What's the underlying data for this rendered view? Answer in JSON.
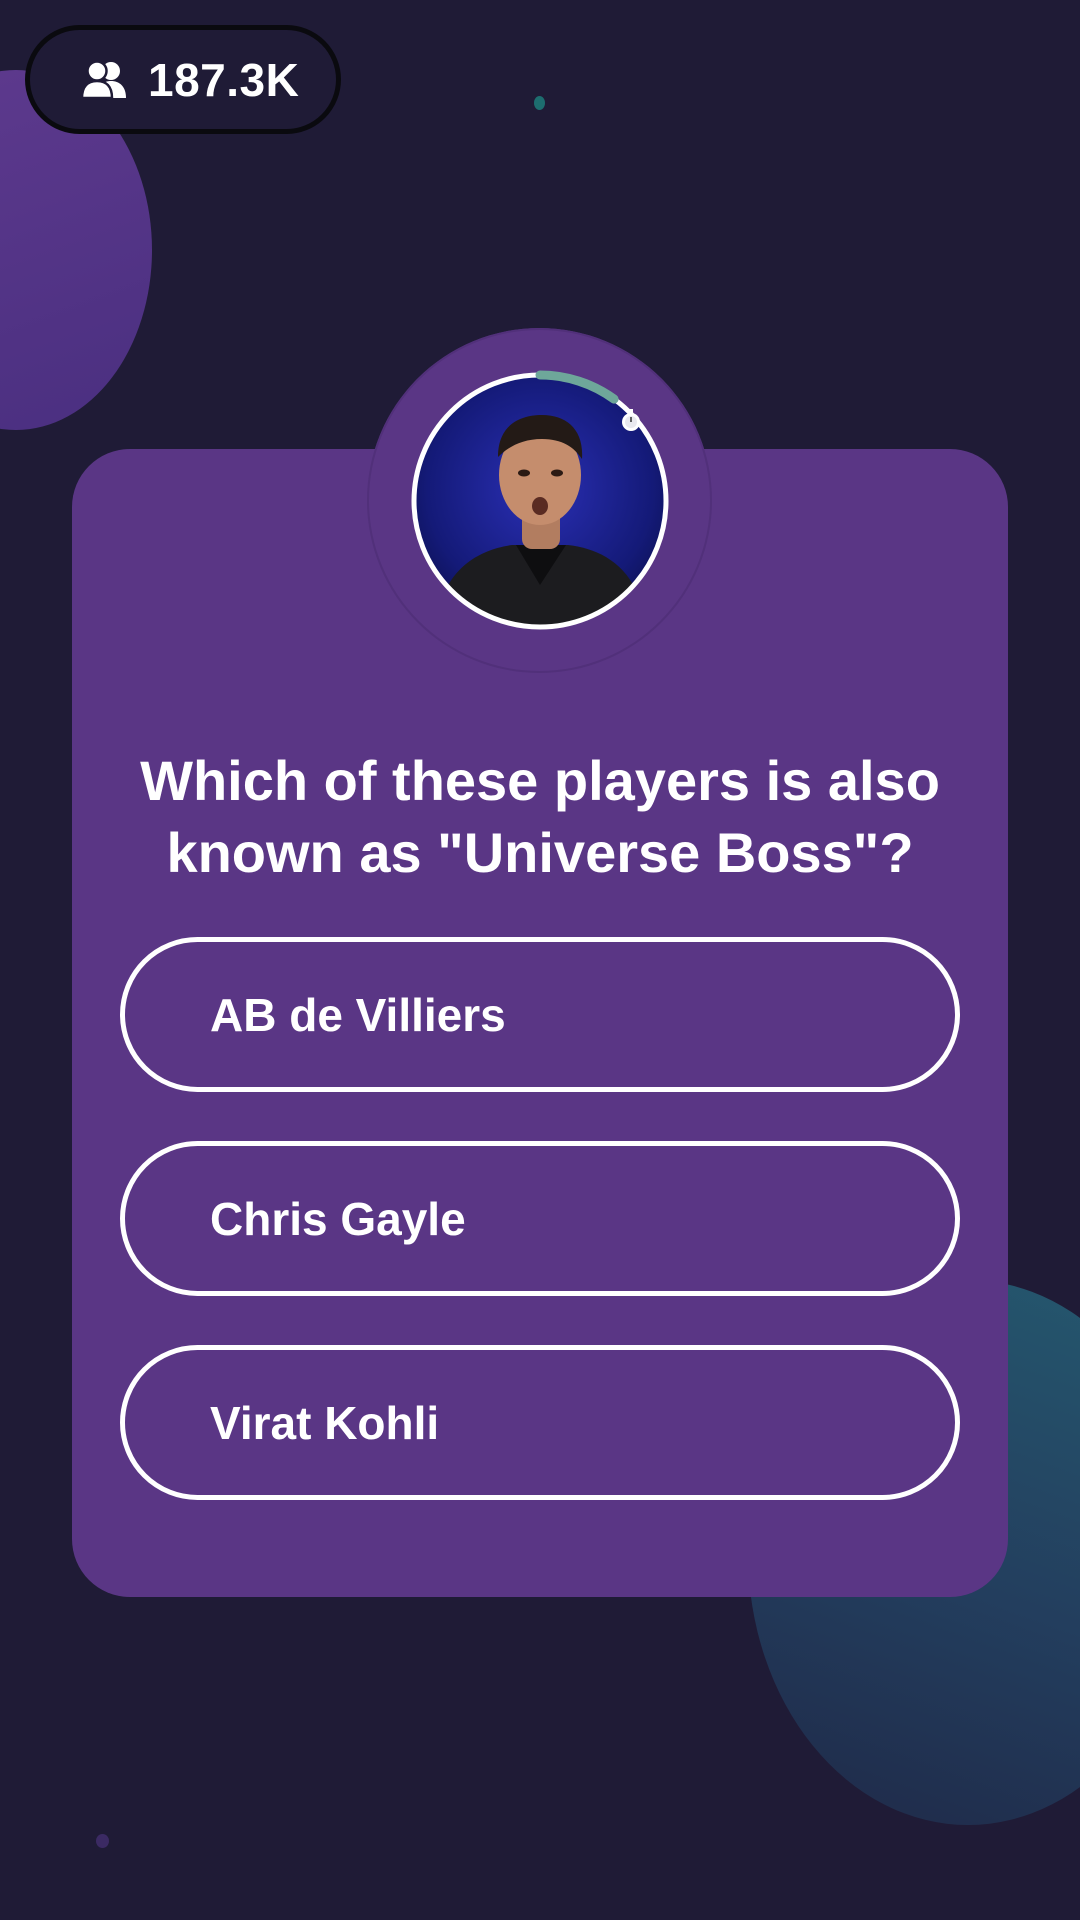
{
  "viewers": {
    "icon": "users-icon",
    "count": "187.3K"
  },
  "host": {
    "photo_icon": "host-video-avatar",
    "timer_icon": "stopwatch-icon",
    "timer_progress": 0.1
  },
  "quiz": {
    "question": "Which of these players is also known as \"Universe Boss\"?",
    "options": [
      {
        "label": "AB de Villiers"
      },
      {
        "label": "Chris Gayle"
      },
      {
        "label": "Virat Kohli"
      }
    ]
  },
  "colors": {
    "background": "#1f1b36",
    "card": "#5a3685",
    "option_border": "#ffffff",
    "timer_arc": "#6ea79a",
    "text": "#ffffff"
  }
}
